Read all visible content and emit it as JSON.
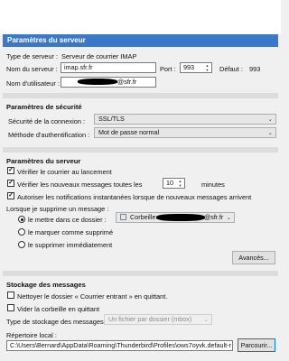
{
  "server": {
    "title": "Paramètres du serveur",
    "type_label": "Type de serveur :",
    "type_value": "Serveur de courrier IMAP",
    "name_label": "Nom du serveur :",
    "name_value": "imap.sfr.fr",
    "port_label": "Port :",
    "port_value": "993",
    "default_label": "Défaut :",
    "default_value": "993",
    "user_label": "Nom d'utilisateur :",
    "user_value": "@sfr.fr"
  },
  "security": {
    "heading": "Paramètres de sécurité",
    "connection_label": "Sécurité de la connexion :",
    "connection_value": "SSL/TLS",
    "auth_label": "Méthode d'authentification :",
    "auth_value": "Mot de passe normal"
  },
  "settings": {
    "heading": "Paramètres du serveur",
    "check_startup": "Vérifier le courrier au lancement",
    "check_startup_checked": true,
    "check_every_prefix": "Vérifier les nouveaux messages toutes les",
    "check_every_value": "10",
    "check_every_suffix": "minutes",
    "check_every_checked": true,
    "push_notif": "Autoriser les notifications instantanées lorsque de nouveaux messages arrivent",
    "push_notif_checked": true,
    "delete_label": "Lorsque je supprime un message :",
    "opt_move": "le mettre dans ce dossier :",
    "opt_move_selected": true,
    "folder_value": "Corbeille",
    "folder_suffix": "@sfr.fr",
    "opt_mark": "le marquer comme supprimé",
    "opt_delete": "le supprimer immédiatement",
    "advanced_button": "Avancés..."
  },
  "storage": {
    "heading": "Stockage des messages",
    "clean_inbox": "Nettoyer le dossier « Courrier entrant » en quittant.",
    "clean_inbox_checked": false,
    "empty_trash": "Vider la corbeille en quittant",
    "empty_trash_checked": false,
    "type_label": "Type de stockage des messages :",
    "type_value": "Un fichier par dossier (mbox)",
    "local_dir_label": "Répertoire local :",
    "local_dir_value": "C:\\Users\\Bernard\\AppData\\Roaming\\Thunderbird\\Profiles\\ows7oyvk.default-r",
    "browse_button": "Parcourir..."
  },
  "colors": {
    "title_bar": "#3a78c8",
    "background": "#f0f0f0",
    "focus_border": "#0078d7"
  }
}
